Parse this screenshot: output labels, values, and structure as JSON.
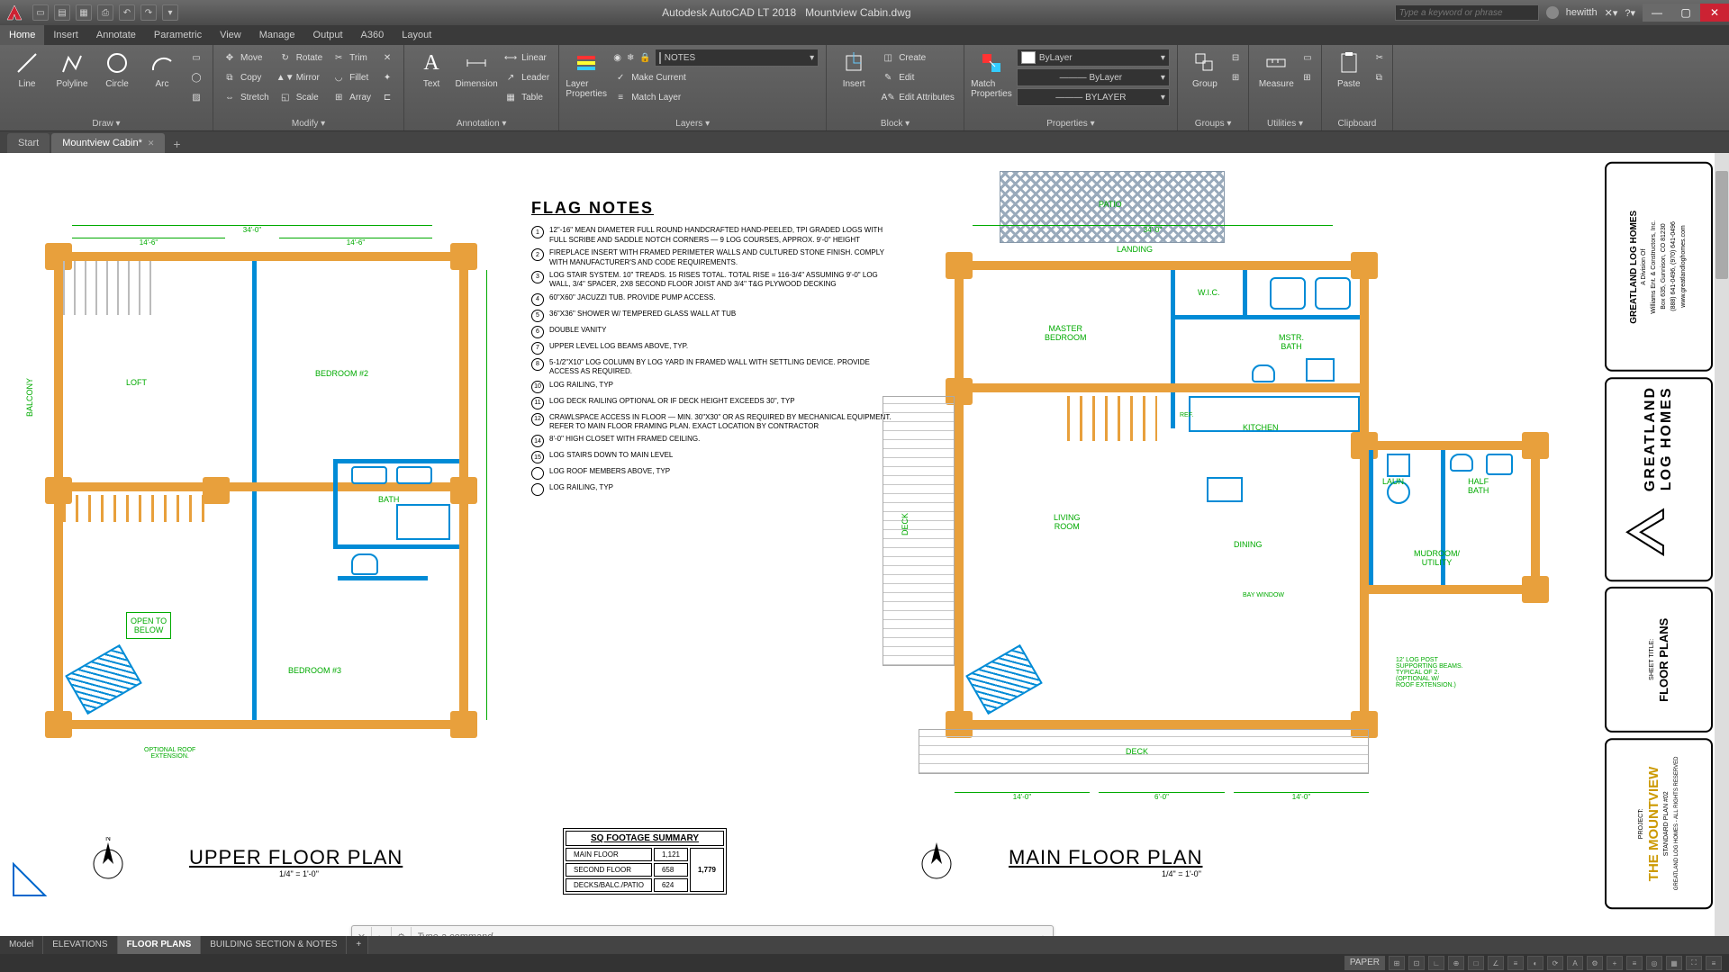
{
  "app": {
    "title_app": "Autodesk AutoCAD LT 2018",
    "title_file": "Mountview Cabin.dwg",
    "search_placeholder": "Type a keyword or phrase",
    "username": "hewitth"
  },
  "menu": {
    "tabs": [
      "Home",
      "Insert",
      "Annotate",
      "Parametric",
      "View",
      "Manage",
      "Output",
      "A360",
      "Layout"
    ],
    "active": "Home"
  },
  "ribbon": {
    "draw": {
      "title": "Draw ▾",
      "line": "Line",
      "polyline": "Polyline",
      "circle": "Circle",
      "arc": "Arc"
    },
    "modify": {
      "title": "Modify ▾",
      "move": "Move",
      "rotate": "Rotate",
      "trim": "Trim",
      "copy": "Copy",
      "mirror": "Mirror",
      "fillet": "Fillet",
      "stretch": "Stretch",
      "scale": "Scale",
      "array": "Array"
    },
    "annotation": {
      "title": "Annotation ▾",
      "text": "Text",
      "dimension": "Dimension",
      "linear": "Linear",
      "leader": "Leader",
      "table": "Table"
    },
    "layers": {
      "title": "Layers ▾",
      "props": "Layer\nProperties",
      "notes": "NOTES",
      "make_current": "Make Current",
      "match_layer": "Match Layer"
    },
    "block": {
      "title": "Block ▾",
      "insert": "Insert",
      "create": "Create",
      "edit": "Edit",
      "edit_attr": "Edit Attributes"
    },
    "properties": {
      "title": "Properties ▾",
      "match": "Match\nProperties",
      "bylayer1": "ByLayer",
      "bylayer2": "ByLayer",
      "bylayer3": "BYLAYER"
    },
    "groups": {
      "title": "Groups ▾",
      "group": "Group"
    },
    "utilities": {
      "title": "Utilities ▾",
      "measure": "Measure"
    },
    "clipboard": {
      "title": "Clipboard",
      "paste": "Paste"
    }
  },
  "filetabs": {
    "start": "Start",
    "current": "Mountview Cabin*"
  },
  "drawing": {
    "upper_plan_title": "UPPER FLOOR PLAN",
    "upper_scale": "1/4\" = 1'-0\"",
    "main_plan_title": "MAIN FLOOR PLAN",
    "main_scale": "1/4\" = 1'-0\"",
    "rooms_upper": {
      "loft": "LOFT",
      "bed2": "BEDROOM #2",
      "bed3": "BEDROOM #3",
      "bath": "BATH",
      "open": "OPEN TO\nBELOW",
      "balc": "BALCONY"
    },
    "rooms_main": {
      "master": "MASTER\nBEDROOM",
      "wic": "W.I.C.",
      "mbath": "MSTR.\nBATH",
      "kitchen": "KITCHEN",
      "living": "LIVING\nROOM",
      "dining": "DINING",
      "laun": "LAUN.",
      "half": "HALF\nBATH",
      "mud": "MUDROOM/\nUTILITY",
      "deck": "DECK",
      "deck2": "DECK",
      "patio": "PATIO",
      "landing": "LANDING",
      "ref": "REF.",
      "bay": "BAY WINDOW"
    },
    "optional_roof": "OPTIONAL ROOF\nEXTENSION.",
    "post_note": "12' LOG POST\nSUPPORTING BEAMS.\nTYPICAL OF 2.\n(OPTIONAL W/\nROOF EXTENSION.)"
  },
  "flag_notes": {
    "title": "FLAG NOTES",
    "items": [
      {
        "n": "1",
        "t": "12\"-16\" MEAN DIAMETER FULL ROUND HANDCRAFTED HAND-PEELED, TPI GRADED LOGS WITH FULL SCRIBE AND SADDLE NOTCH CORNERS — 9 LOG COURSES, APPROX. 9'-0\" HEIGHT"
      },
      {
        "n": "2",
        "t": "FIREPLACE INSERT WITH FRAMED PERIMETER WALLS AND CULTURED STONE FINISH. COMPLY WITH MANUFACTURER'S AND CODE REQUIREMENTS."
      },
      {
        "n": "3",
        "t": "LOG STAIR SYSTEM. 10\" TREADS. 15 RISES TOTAL. TOTAL RISE = 116-3/4\" ASSUMING 9'-0\" LOG WALL, 3/4\" SPACER, 2x8 SECOND FLOOR JOIST AND 3/4\" T&G PLYWOOD DECKING"
      },
      {
        "n": "4",
        "t": "60\"x60\" JACUZZI TUB. PROVIDE PUMP ACCESS."
      },
      {
        "n": "5",
        "t": "36\"x36\" SHOWER w/ TEMPERED GLASS WALL AT TUB"
      },
      {
        "n": "6",
        "t": "DOUBLE VANITY"
      },
      {
        "n": "7",
        "t": "UPPER LEVEL LOG BEAMS ABOVE, TYP."
      },
      {
        "n": "8",
        "t": "5-1/2\"x10\" LOG COLUMN BY LOG YARD IN FRAMED WALL WITH SETTLING DEVICE. PROVIDE ACCESS AS REQUIRED."
      },
      {
        "n": "10",
        "t": "LOG RAILING, TYP"
      },
      {
        "n": "11",
        "t": "LOG DECK RAILING OPTIONAL OR IF DECK HEIGHT EXCEEDS 30\", TYP"
      },
      {
        "n": "12",
        "t": "CRAWLSPACE ACCESS IN FLOOR — MIN. 30\"x30\" OR AS REQUIRED BY MECHANICAL EQUIPMENT. REFER TO MAIN FLOOR FRAMING PLAN. EXACT LOCATION BY CONTRACTOR"
      },
      {
        "n": "14",
        "t": "8'-0\" HIGH CLOSET WITH FRAMED CEILING."
      },
      {
        "n": "15",
        "t": "LOG STAIRS DOWN TO MAIN LEVEL"
      },
      {
        "n": "",
        "t": "LOG ROOF MEMBERS ABOVE, TYP"
      },
      {
        "n": "",
        "t": "LOG RAILING, TYP"
      }
    ]
  },
  "sqft": {
    "title": "SQ FOOTAGE SUMMARY",
    "rows": [
      {
        "label": "MAIN FLOOR",
        "a": "1,121",
        "b": ""
      },
      {
        "label": "SECOND FLOOR",
        "a": "658",
        "b": "1,779"
      },
      {
        "label": "DECKS/BALC./PATIO",
        "a": "624",
        "b": ""
      }
    ]
  },
  "titleblock": {
    "company": "GREATLAND LOG HOMES",
    "division": "A Division Of\nWilliams Ent. & Constructors, Inc.\nBox 635, Gunnison, CO 81230\n(888) 641-0496, (970) 641-0496\nwww.greatlandloghomes.com",
    "logo": "GREATLAND\nLOG HOMES",
    "sheet_title_label": "SHEET TITLE:",
    "sheet_title": "FLOOR PLANS",
    "project_label": "PROJECT:",
    "project": "THE MOUNTVIEW",
    "plan_no": "STANDARD PLAN #02",
    "rights": "GREATLAND LOG HOMES - ALL RIGHTS RESERVED"
  },
  "cmd": {
    "placeholder": "Type a command"
  },
  "layout_tabs": [
    "Model",
    "ELEVATIONS",
    "FLOOR PLANS",
    "BUILDING SECTION & NOTES"
  ],
  "layout_active": "FLOOR PLANS",
  "status": {
    "space": "PAPER"
  }
}
